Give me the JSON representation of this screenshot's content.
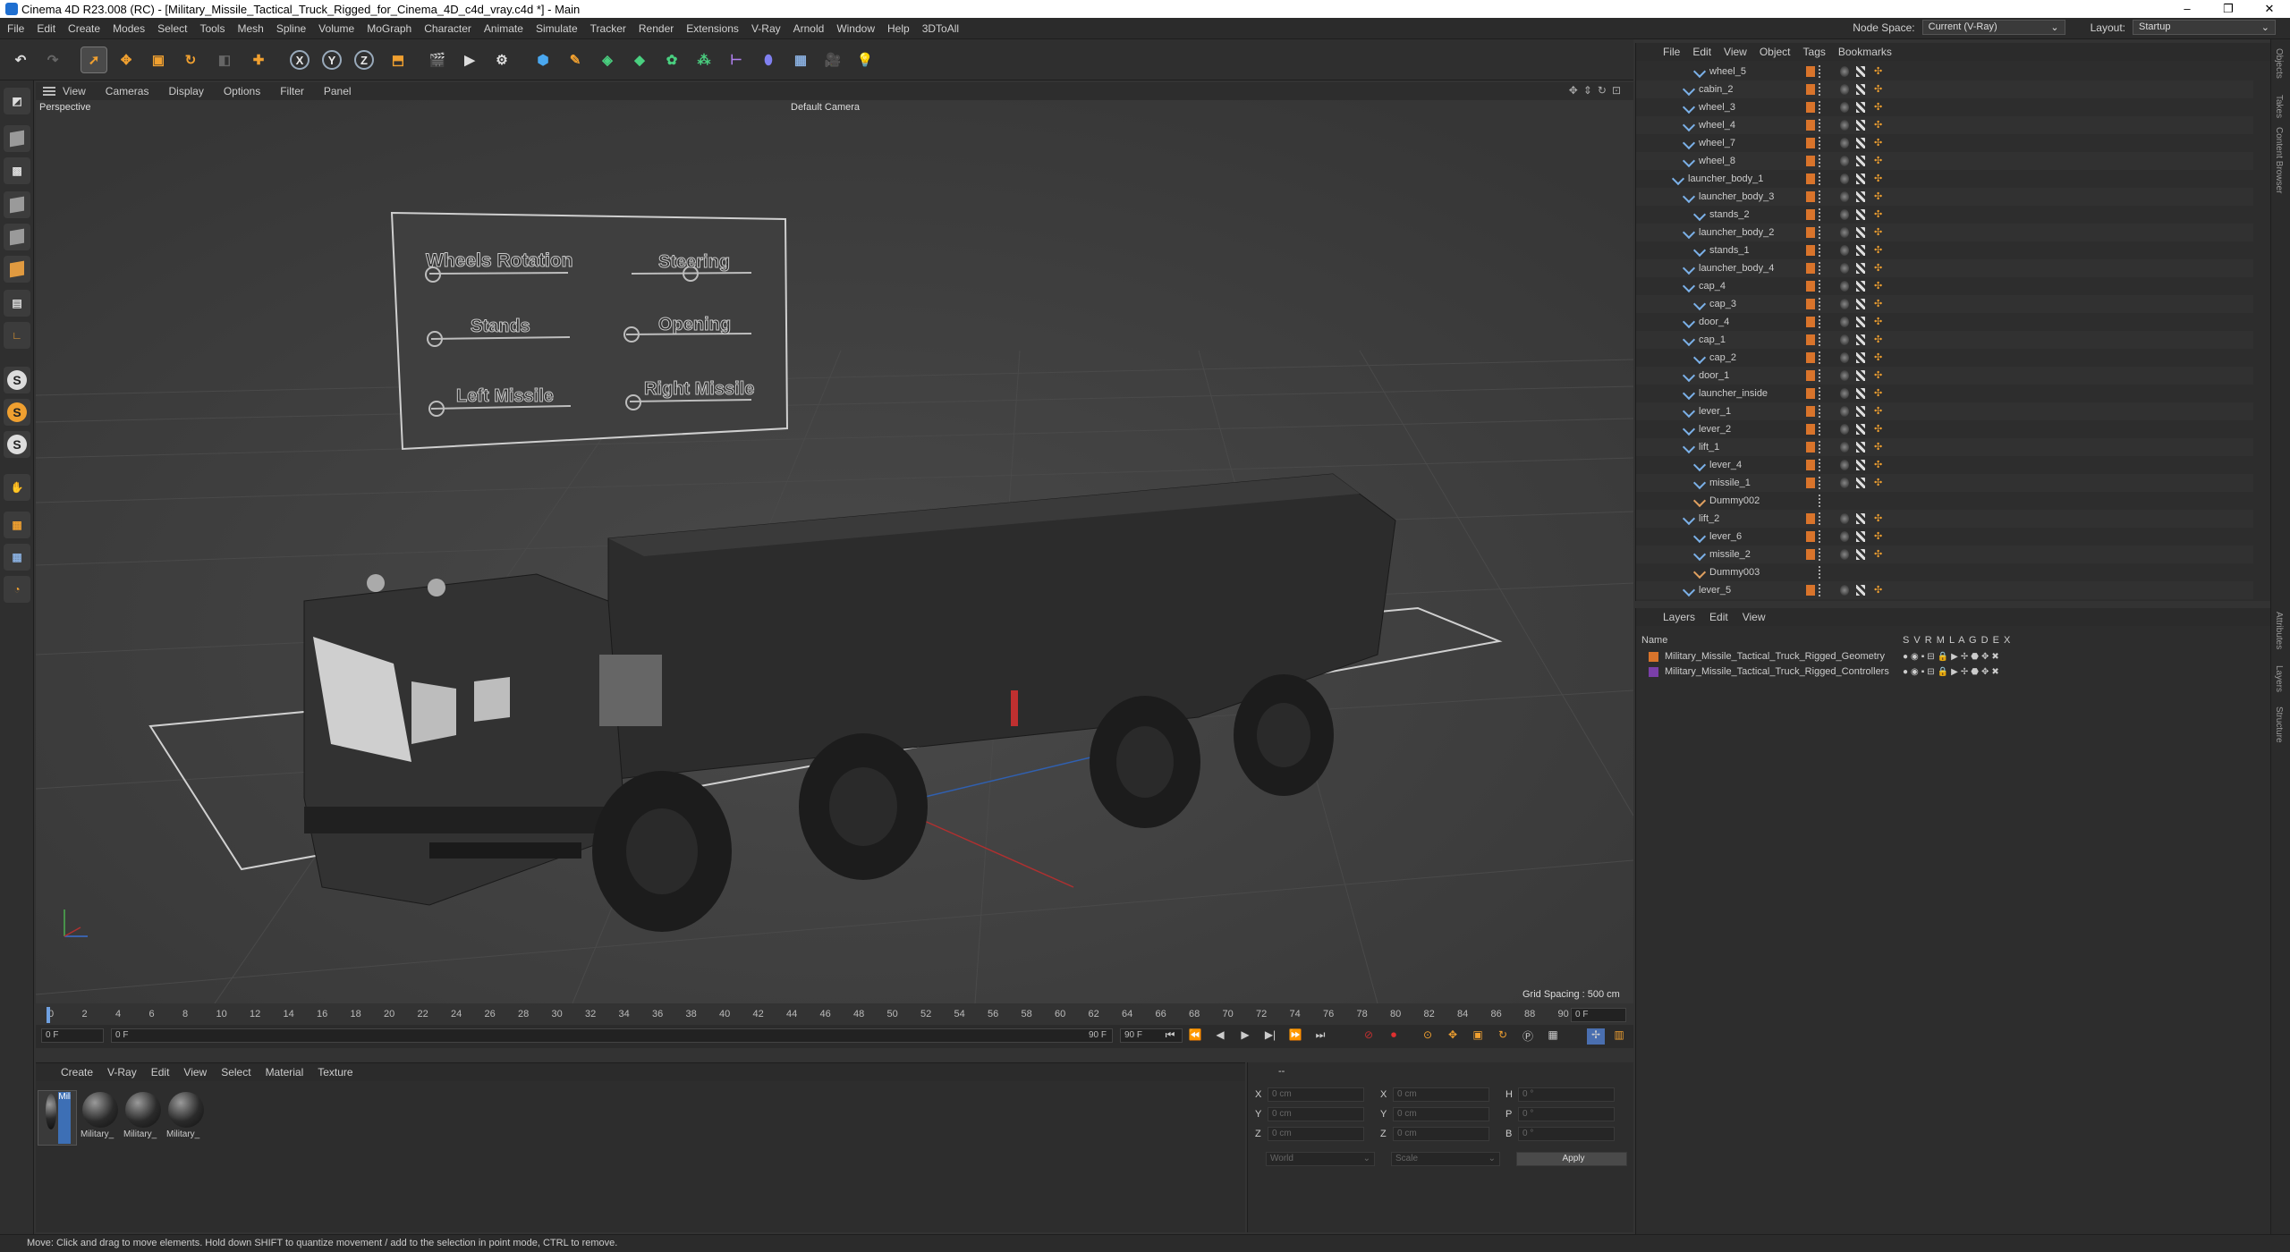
{
  "window": {
    "title": "Cinema 4D R23.008 (RC) - [Military_Missile_Tactical_Truck_Rigged_for_Cinema_4D_c4d_vray.c4d *] - Main",
    "controls": [
      "–",
      "❐",
      "✕"
    ]
  },
  "menu": [
    "File",
    "Edit",
    "Create",
    "Modes",
    "Select",
    "Tools",
    "Mesh",
    "Spline",
    "Volume",
    "MoGraph",
    "Character",
    "Animate",
    "Simulate",
    "Tracker",
    "Render",
    "Extensions",
    "V-Ray",
    "Arnold",
    "Window",
    "Help",
    "3DToAll"
  ],
  "node_space": {
    "label": "Node Space:",
    "value": "Current (V-Ray)"
  },
  "layout": {
    "label": "Layout:",
    "value": "Startup"
  },
  "toolbar": {
    "axis_x": "X",
    "axis_y": "Y",
    "axis_z": "Z"
  },
  "viewport": {
    "menu": [
      "View",
      "Cameras",
      "Display",
      "Options",
      "Filter",
      "Panel"
    ],
    "mode": "Perspective",
    "camera": "Default Camera",
    "grid_spacing": "Grid Spacing : 500 cm",
    "controls": {
      "wheels_rotation": "Wheels Rotation",
      "steering": "Steering",
      "stands": "Stands",
      "opening": "Opening",
      "left_missile": "Left Missile",
      "right_missile": "Right Missile"
    }
  },
  "timeline": {
    "ticks": [
      "0",
      "2",
      "4",
      "6",
      "8",
      "10",
      "12",
      "14",
      "16",
      "18",
      "20",
      "22",
      "24",
      "26",
      "28",
      "30",
      "32",
      "34",
      "36",
      "38",
      "40",
      "42",
      "44",
      "46",
      "48",
      "50",
      "52",
      "54",
      "56",
      "58",
      "60",
      "62",
      "64",
      "66",
      "68",
      "70",
      "72",
      "74",
      "76",
      "78",
      "80",
      "82",
      "84",
      "86",
      "88",
      "90"
    ],
    "current_end": "0 F",
    "start": "0 F",
    "preview_start": "0 F",
    "preview_end": "90 F",
    "end": "90 F"
  },
  "materials": {
    "menu": [
      "Create",
      "V-Ray",
      "Edit",
      "View",
      "Select",
      "Material",
      "Texture"
    ],
    "items": [
      "Military",
      "Military_",
      "Military_",
      "Military_"
    ]
  },
  "attributes": {
    "header": "--",
    "labels": {
      "x": "X",
      "y": "Y",
      "z": "Z",
      "x2": "X",
      "y2": "Y",
      "z2": "Z",
      "h": "H",
      "p": "P",
      "b": "B"
    },
    "values": {
      "x": "0 cm",
      "y": "0 cm",
      "z": "0 cm",
      "x2": "0 cm",
      "y2": "0 cm",
      "z2": "0 cm",
      "h": "0 °",
      "p": "0 °",
      "b": "0 °"
    },
    "world": "World",
    "scale": "Scale",
    "apply": "Apply"
  },
  "status": "Move: Click and drag to move elements. Hold down SHIFT to quantize movement / add to the selection in point mode, CTRL to remove.",
  "objects": {
    "menu": [
      "File",
      "Edit",
      "View",
      "Object",
      "Tags",
      "Bookmarks"
    ],
    "rows": [
      {
        "name": "wheel_5",
        "indent": 3
      },
      {
        "name": "cabin_2",
        "indent": 2
      },
      {
        "name": "wheel_3",
        "indent": 2
      },
      {
        "name": "wheel_4",
        "indent": 2
      },
      {
        "name": "wheel_7",
        "indent": 2
      },
      {
        "name": "wheel_8",
        "indent": 2
      },
      {
        "name": "launcher_body_1",
        "indent": 1
      },
      {
        "name": "launcher_body_3",
        "indent": 2
      },
      {
        "name": "stands_2",
        "indent": 3
      },
      {
        "name": "launcher_body_2",
        "indent": 2
      },
      {
        "name": "stands_1",
        "indent": 3
      },
      {
        "name": "launcher_body_4",
        "indent": 2
      },
      {
        "name": "cap_4",
        "indent": 2
      },
      {
        "name": "cap_3",
        "indent": 3
      },
      {
        "name": "door_4",
        "indent": 2
      },
      {
        "name": "cap_1",
        "indent": 2
      },
      {
        "name": "cap_2",
        "indent": 3
      },
      {
        "name": "door_1",
        "indent": 2
      },
      {
        "name": "launcher_inside",
        "indent": 2
      },
      {
        "name": "lever_1",
        "indent": 2
      },
      {
        "name": "lever_2",
        "indent": 2
      },
      {
        "name": "lift_1",
        "indent": 2
      },
      {
        "name": "lever_4",
        "indent": 3
      },
      {
        "name": "missile_1",
        "indent": 3
      },
      {
        "name": "Dummy002",
        "indent": 3
      },
      {
        "name": "lift_2",
        "indent": 2
      },
      {
        "name": "lever_6",
        "indent": 3
      },
      {
        "name": "missile_2",
        "indent": 3
      },
      {
        "name": "Dummy003",
        "indent": 3
      },
      {
        "name": "lever_5",
        "indent": 2
      }
    ]
  },
  "layers": {
    "menu": [
      "Layers",
      "Edit",
      "View"
    ],
    "col_name": "Name",
    "cols": [
      "S",
      "V",
      "R",
      "M",
      "L",
      "A",
      "G",
      "D",
      "E",
      "X"
    ],
    "items": [
      {
        "name": "Military_Missile_Tactical_Truck_Rigged_Geometry",
        "color": "#d9742b"
      },
      {
        "name": "Military_Missile_Tactical_Truck_Rigged_Controllers",
        "color": "#7a3fa8"
      }
    ]
  },
  "side_tabs": [
    "Objects",
    "Takes",
    "Content Browser",
    "Attributes",
    "Layers",
    "Structure"
  ]
}
